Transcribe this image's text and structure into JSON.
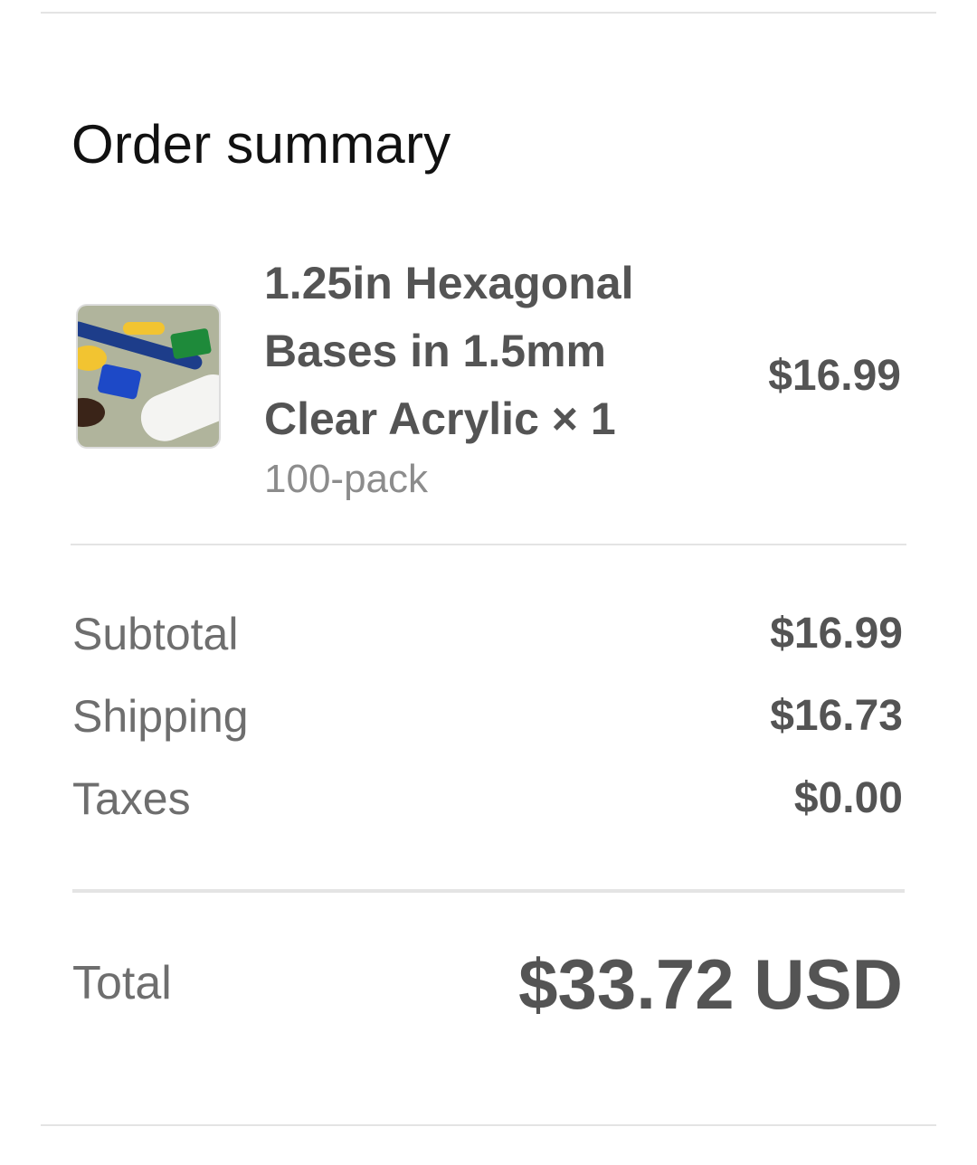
{
  "order_summary": {
    "title": "Order summary",
    "item": {
      "name": "1.25in Hexagonal Bases in 1.5mm Clear Acrylic × 1",
      "variant": "100-pack",
      "price": "$16.99",
      "image_alt": "product-thumbnail"
    },
    "lines": [
      {
        "label": "Subtotal",
        "value": "$16.99"
      },
      {
        "label": "Shipping",
        "value": "$16.73"
      },
      {
        "label": "Taxes",
        "value": "$0.00"
      }
    ],
    "total": {
      "label": "Total",
      "value": "$33.72 USD"
    }
  },
  "colors": {
    "title_text": "#111111",
    "strong_text": "#545454",
    "label_text": "#6e6e6e",
    "muted_text": "#8c8c8c",
    "divider": "#e4e4e4"
  }
}
